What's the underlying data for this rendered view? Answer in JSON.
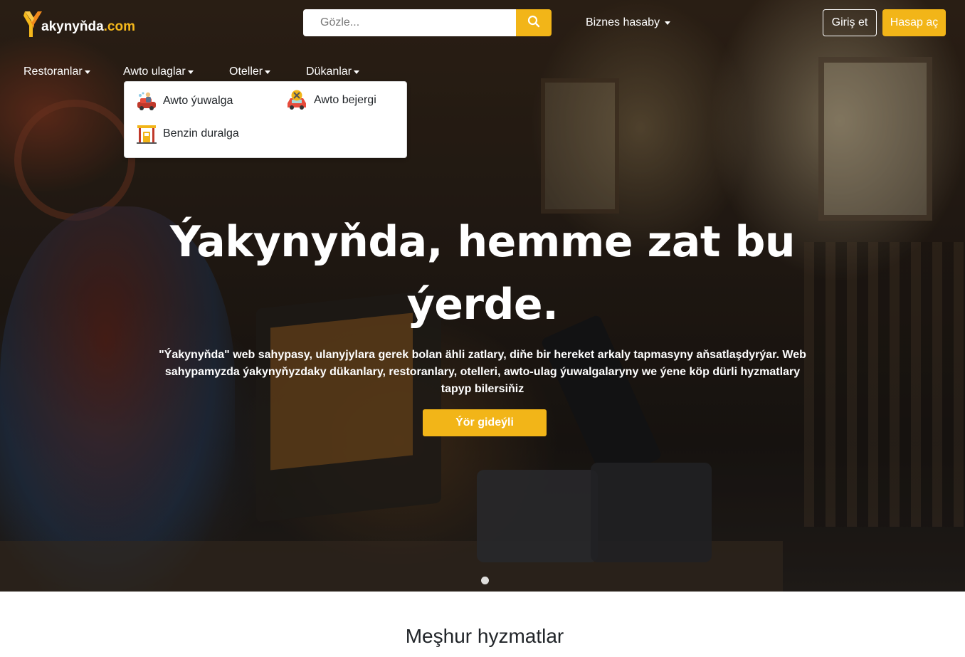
{
  "header": {
    "logo_initial": "Y",
    "logo_text": "akynyňda",
    "logo_domain": ".com",
    "search": {
      "placeholder": "Gözle..."
    },
    "business_menu": "Biznes hasaby",
    "login": "Giriş et",
    "signup": "Hasap aç"
  },
  "nav": {
    "items": [
      {
        "label": "Restoranlar"
      },
      {
        "label": "Awto ulaglar"
      },
      {
        "label": "Oteller"
      },
      {
        "label": "Dükanlar"
      }
    ]
  },
  "dropdown": {
    "items": [
      {
        "label": "Awto ýuwalga",
        "icon": "car-wash-icon"
      },
      {
        "label": "Awto bejergi",
        "icon": "car-repair-icon"
      },
      {
        "label": "Benzin duralga",
        "icon": "gas-station-icon"
      }
    ]
  },
  "hero": {
    "title": "Ýakynyňda, hemme zat bu ýerde.",
    "description": "\"Ýakynyňda\" web sahypasy, ulanyjylara gerek bolan ähli zatlary, diňe bir hereket arkaly tapmasyny aňsatlaşdyrýar. Web sahypamyzda ýakynyňyzdaky dükanlary, restoranlary, otelleri, awto-ulag ýuwalgalaryny we ýene köp dürli hyzmatlary tapyp bilersiňiz",
    "button": "Ýör gideýli"
  },
  "section": {
    "title": "Meşhur hyzmatlar"
  },
  "colors": {
    "accent": "#f2b518",
    "text_dark": "#212529"
  }
}
